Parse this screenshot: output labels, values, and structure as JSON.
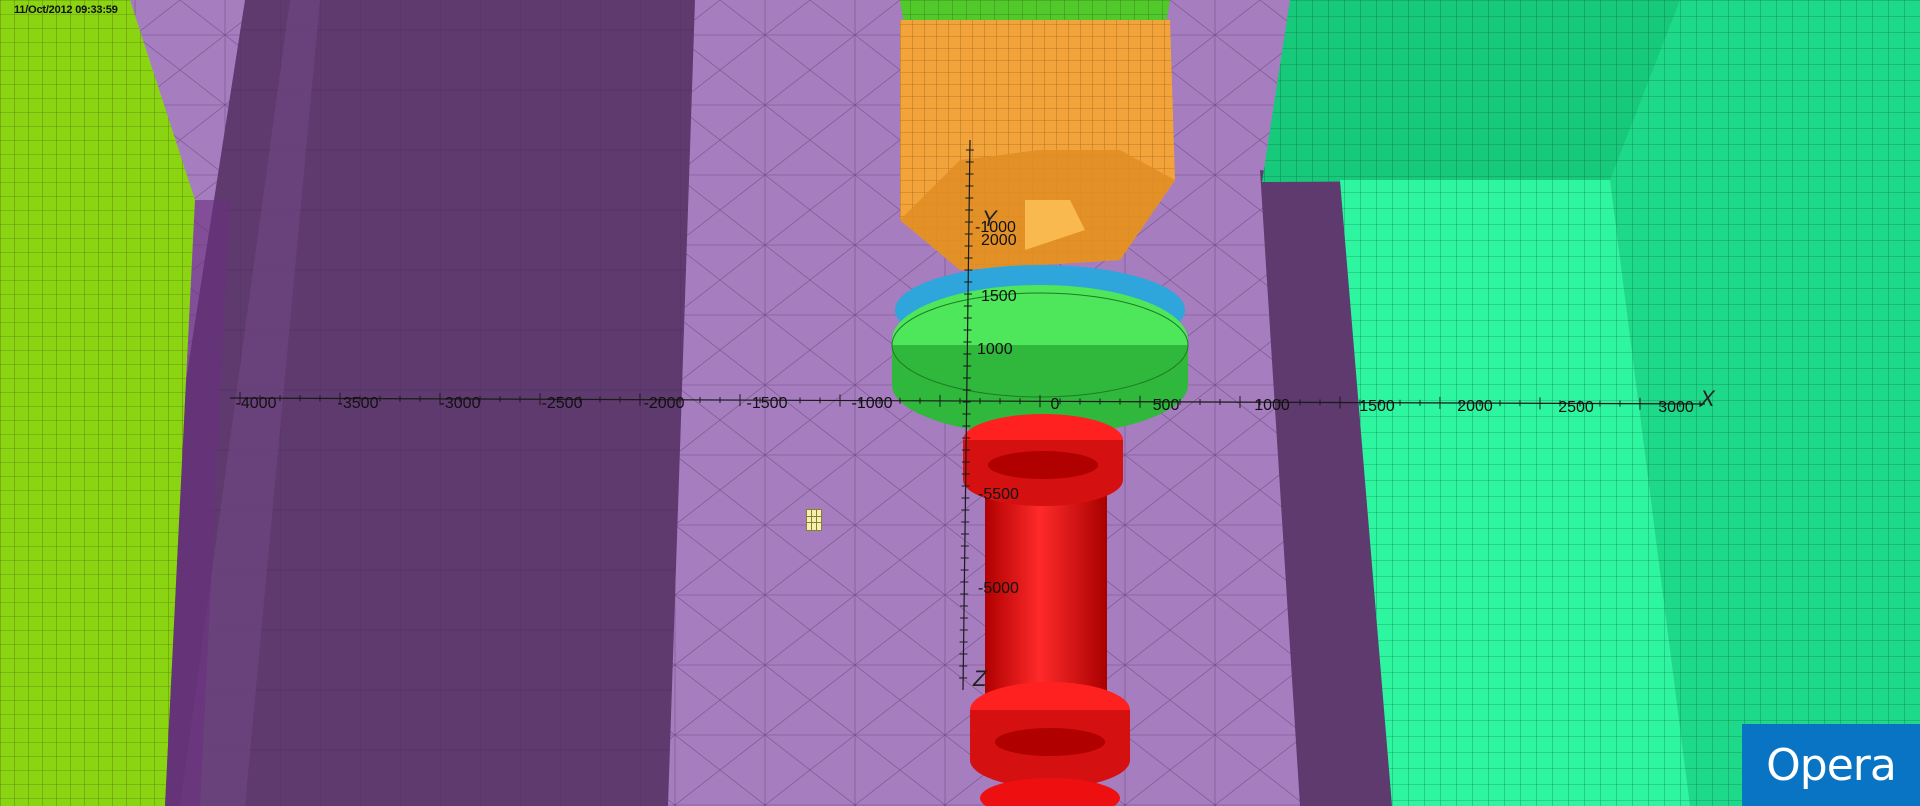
{
  "window": {
    "timestamp": "11/Oct/2012 09:33:59",
    "brand_label": "Opera"
  },
  "axes": {
    "x_letter": "X",
    "y_letter": "Y",
    "z_letter": "Z",
    "x_ticks": [
      "-4000",
      "-3500",
      "-3000",
      "-2500",
      "-2000",
      "-1500",
      "-1000",
      "0",
      "500",
      "1000",
      "1500",
      "2000",
      "2500",
      "3000"
    ],
    "y_ticks": [
      "2000",
      "1500",
      "1000"
    ],
    "z_ticks": [
      "-5500",
      "-5000"
    ],
    "extra_label": "-1000"
  },
  "colors": {
    "background_floor": "#a67dbf",
    "dark_wall": "#5e3a6e",
    "lime_block": "#8bd412",
    "green_block": "#17c97a",
    "cyan_green_block": "#2ef5a0",
    "orange_part": "#f2a33a",
    "blue_ring": "#2ea6db",
    "green_disc": "#3ed24a",
    "red_pillar": "#ee1010",
    "brand_blue": "#0a74c4"
  }
}
